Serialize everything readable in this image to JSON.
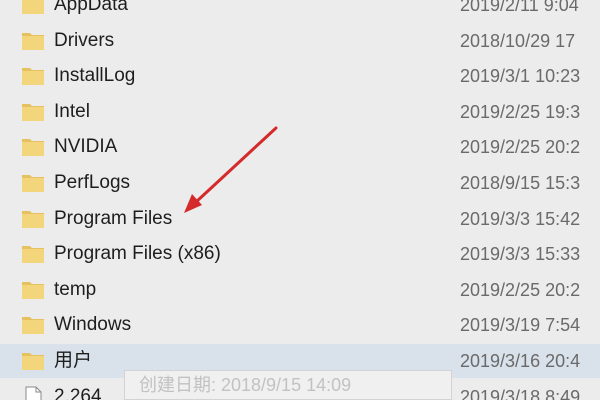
{
  "file_list": {
    "rows": [
      {
        "name": "AppData",
        "modified": "2019/2/11 9:04",
        "icon": "folder-icon",
        "type": "folder"
      },
      {
        "name": "Drivers",
        "modified": "2018/10/29 17",
        "icon": "folder-icon",
        "type": "folder"
      },
      {
        "name": "InstallLog",
        "modified": "2019/3/1 10:23",
        "icon": "folder-icon",
        "type": "folder"
      },
      {
        "name": "Intel",
        "modified": "2019/2/25 19:3",
        "icon": "folder-icon",
        "type": "folder"
      },
      {
        "name": "NVIDIA",
        "modified": "2019/2/25 20:2",
        "icon": "folder-icon",
        "type": "folder"
      },
      {
        "name": "PerfLogs",
        "modified": "2018/9/15 15:3",
        "icon": "folder-icon",
        "type": "folder"
      },
      {
        "name": "Program Files",
        "modified": "2019/3/3 15:42",
        "icon": "folder-icon",
        "type": "folder"
      },
      {
        "name": "Program Files (x86)",
        "modified": "2019/3/3 15:33",
        "icon": "folder-icon",
        "type": "folder"
      },
      {
        "name": "temp",
        "modified": "2019/2/25 20:2",
        "icon": "folder-icon",
        "type": "folder"
      },
      {
        "name": "Windows",
        "modified": "2019/3/19 7:54",
        "icon": "folder-icon",
        "type": "folder"
      },
      {
        "name": "用户",
        "modified": "2019/3/16 20:4",
        "icon": "folder-icon",
        "type": "folder",
        "selected": true
      },
      {
        "name": "2.264",
        "modified": "2019/3/18 8:49",
        "icon": "file-icon",
        "type": "file"
      }
    ]
  },
  "tooltip": {
    "text": "创建日期: 2018/9/15 14:09"
  },
  "colors": {
    "background": "#ececec",
    "selected_row": "#d9e1ea",
    "folder_fill": "#f3d57c",
    "folder_tab": "#e6c160",
    "annotation_arrow": "#d42a2a",
    "date_text": "#6a6a6a"
  },
  "annotation": {
    "type": "arrow",
    "points_to": "Program Files"
  }
}
